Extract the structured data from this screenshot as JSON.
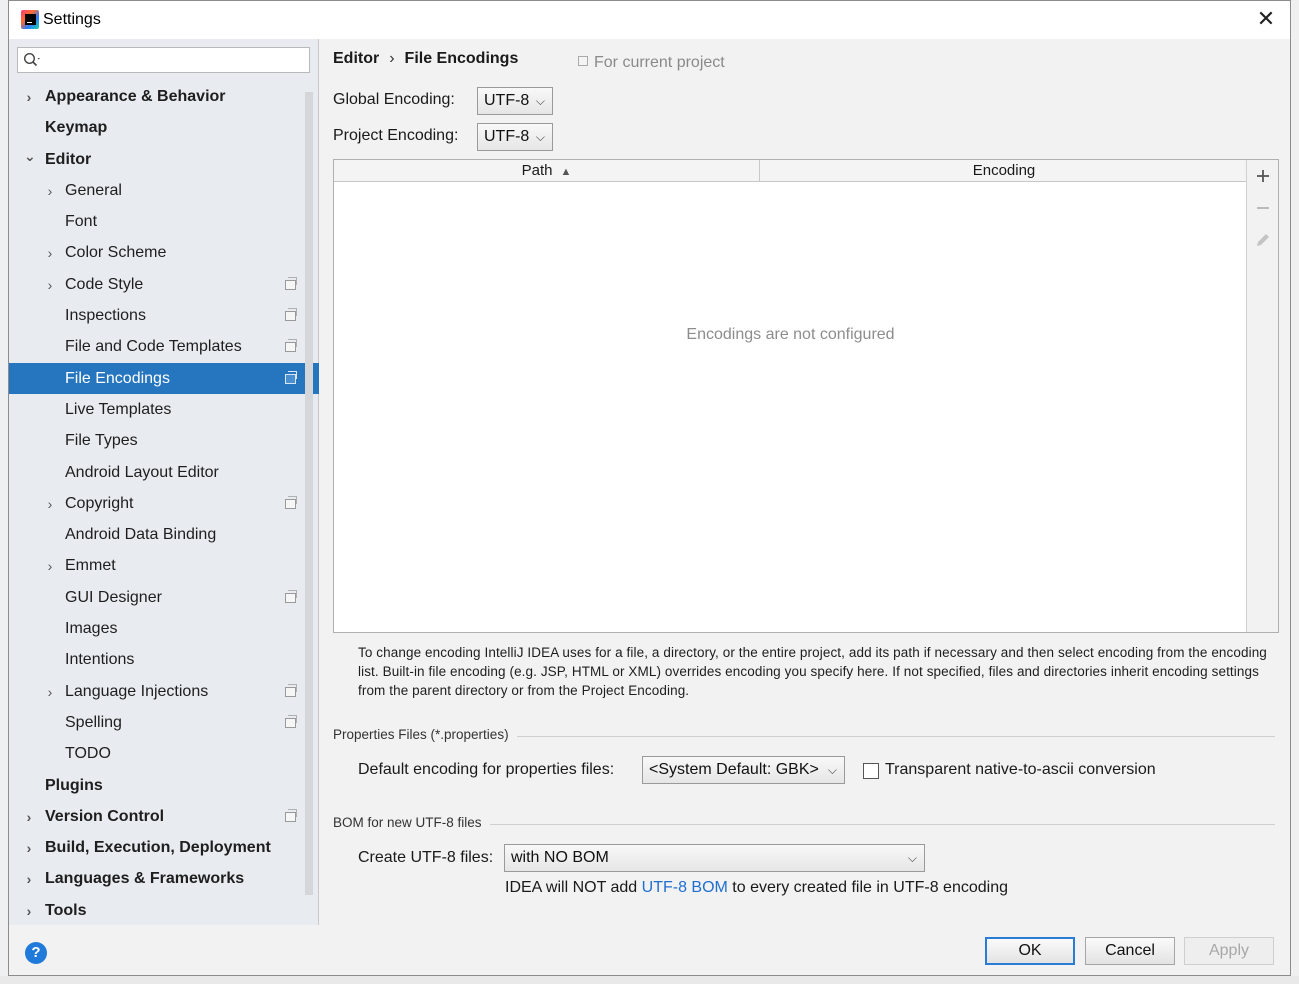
{
  "window": {
    "title": "Settings"
  },
  "search": {
    "placeholder": ""
  },
  "sidebar": {
    "items": [
      {
        "label": "Appearance & Behavior",
        "level": 0,
        "expandable": true,
        "expanded": false,
        "project": false
      },
      {
        "label": "Keymap",
        "level": 0,
        "expandable": false,
        "project": false
      },
      {
        "label": "Editor",
        "level": 0,
        "expandable": true,
        "expanded": true,
        "project": false
      },
      {
        "label": "General",
        "level": 1,
        "expandable": true,
        "expanded": false,
        "project": false
      },
      {
        "label": "Font",
        "level": 1,
        "expandable": false,
        "project": false
      },
      {
        "label": "Color Scheme",
        "level": 1,
        "expandable": true,
        "expanded": false,
        "project": false
      },
      {
        "label": "Code Style",
        "level": 1,
        "expandable": true,
        "expanded": false,
        "project": true
      },
      {
        "label": "Inspections",
        "level": 1,
        "expandable": false,
        "project": true
      },
      {
        "label": "File and Code Templates",
        "level": 1,
        "expandable": false,
        "project": true
      },
      {
        "label": "File Encodings",
        "level": 1,
        "expandable": false,
        "project": true,
        "selected": true
      },
      {
        "label": "Live Templates",
        "level": 1,
        "expandable": false,
        "project": false
      },
      {
        "label": "File Types",
        "level": 1,
        "expandable": false,
        "project": false
      },
      {
        "label": "Android Layout Editor",
        "level": 1,
        "expandable": false,
        "project": false
      },
      {
        "label": "Copyright",
        "level": 1,
        "expandable": true,
        "expanded": false,
        "project": true
      },
      {
        "label": "Android Data Binding",
        "level": 1,
        "expandable": false,
        "project": false
      },
      {
        "label": "Emmet",
        "level": 1,
        "expandable": true,
        "expanded": false,
        "project": false
      },
      {
        "label": "GUI Designer",
        "level": 1,
        "expandable": false,
        "project": true
      },
      {
        "label": "Images",
        "level": 1,
        "expandable": false,
        "project": false
      },
      {
        "label": "Intentions",
        "level": 1,
        "expandable": false,
        "project": false
      },
      {
        "label": "Language Injections",
        "level": 1,
        "expandable": true,
        "expanded": false,
        "project": true
      },
      {
        "label": "Spelling",
        "level": 1,
        "expandable": false,
        "project": true
      },
      {
        "label": "TODO",
        "level": 1,
        "expandable": false,
        "project": false
      },
      {
        "label": "Plugins",
        "level": 0,
        "expandable": false,
        "project": false
      },
      {
        "label": "Version Control",
        "level": 0,
        "expandable": true,
        "expanded": false,
        "project": true
      },
      {
        "label": "Build, Execution, Deployment",
        "level": 0,
        "expandable": true,
        "expanded": false,
        "project": false
      },
      {
        "label": "Languages & Frameworks",
        "level": 0,
        "expandable": true,
        "expanded": false,
        "project": false
      },
      {
        "label": "Tools",
        "level": 0,
        "expandable": true,
        "expanded": false,
        "project": false
      }
    ]
  },
  "breadcrumb": {
    "parent": "Editor",
    "separator": "›",
    "current": "File Encodings"
  },
  "scope_note": "For current project",
  "global_encoding": {
    "label": "Global Encoding:",
    "value": "UTF-8"
  },
  "project_encoding": {
    "label": "Project Encoding:",
    "value": "UTF-8"
  },
  "table": {
    "columns": [
      "Path",
      "Encoding"
    ],
    "sort_indicator": "▲",
    "empty_text": "Encodings are not configured",
    "rows": []
  },
  "help_text": "To change encoding IntelliJ IDEA uses for a file, a directory, or the entire project, add its path if necessary and then select encoding from the encoding list. Built-in file encoding (e.g. JSP, HTML or XML) overrides encoding you specify here. If not specified, files and directories inherit encoding settings from the parent directory or from the Project Encoding.",
  "properties_section": {
    "title": "Properties Files (*.properties)",
    "default_label": "Default encoding for properties files:",
    "default_value": "<System Default: GBK>",
    "transparent_label": "Transparent native-to-ascii conversion",
    "transparent_checked": false
  },
  "bom_section": {
    "title": "BOM for new UTF-8 files",
    "create_label": "Create UTF-8 files:",
    "create_value": "with NO BOM",
    "note_prefix": "IDEA will NOT add ",
    "note_link": "UTF-8 BOM",
    "note_suffix": " to every created file in UTF-8 encoding"
  },
  "buttons": {
    "ok": "OK",
    "cancel": "Cancel",
    "apply": "Apply",
    "help": "?"
  },
  "colors": {
    "selection": "#2675bf",
    "link": "#1f6fd1",
    "help": "#1f7ad9"
  }
}
